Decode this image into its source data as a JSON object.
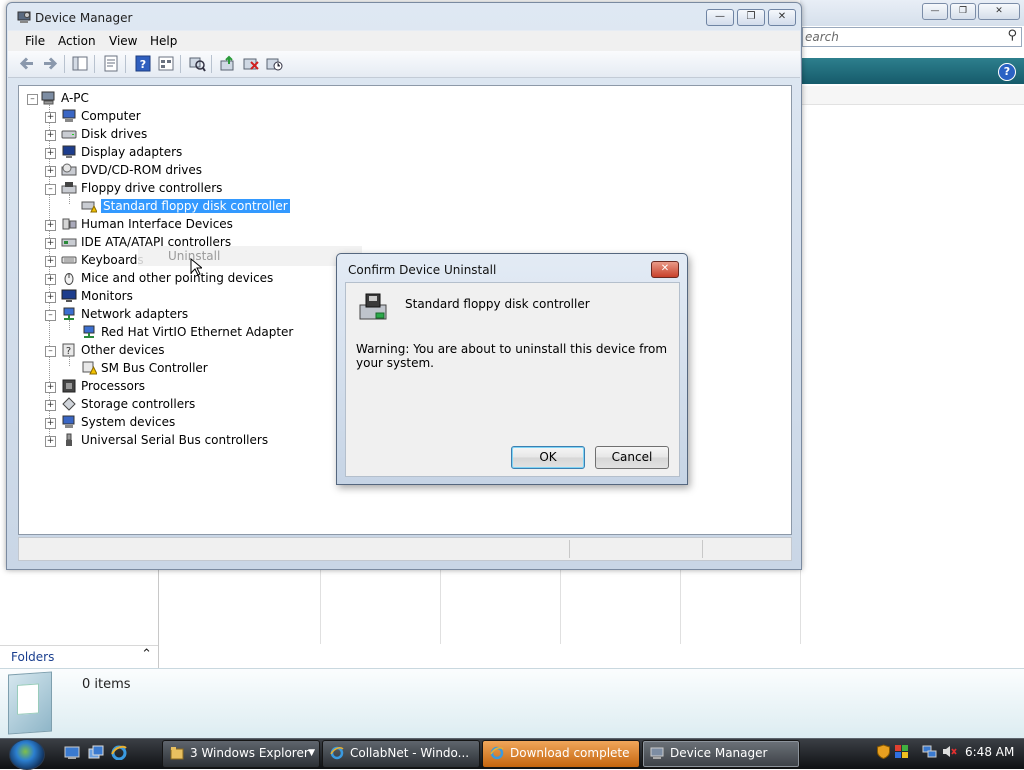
{
  "background": {
    "search_placeholder": "earch",
    "folders_label": "Folders",
    "items_count": "0 items"
  },
  "device_manager": {
    "title": "Device Manager",
    "menu": [
      "File",
      "Action",
      "View",
      "Help"
    ],
    "tree": {
      "root": "A-PC",
      "categories": [
        {
          "label": "Computer"
        },
        {
          "label": "Disk drives"
        },
        {
          "label": "Display adapters"
        },
        {
          "label": "DVD/CD-ROM drives"
        },
        {
          "label": "Floppy drive controllers",
          "expanded": true,
          "children": [
            "Standard floppy disk controller"
          ]
        },
        {
          "label": "Human Interface Devices"
        },
        {
          "label": "IDE ATA/ATAPI controllers"
        },
        {
          "label": "Keyboards"
        },
        {
          "label": "Mice and other pointing devices"
        },
        {
          "label": "Monitors"
        },
        {
          "label": "Network adapters",
          "expanded": true,
          "children": [
            "Red Hat VirtIO Ethernet Adapter"
          ]
        },
        {
          "label": "Other devices",
          "expanded": true,
          "children": [
            "SM Bus Controller"
          ]
        },
        {
          "label": "Processors"
        },
        {
          "label": "Storage controllers"
        },
        {
          "label": "System devices"
        },
        {
          "label": "Universal Serial Bus controllers"
        }
      ],
      "selected": "Standard floppy disk controller"
    },
    "context_ghost": "Uninstall"
  },
  "dialog": {
    "title": "Confirm Device Uninstall",
    "device_name": "Standard floppy disk controller",
    "warning": "Warning: You are about to uninstall this device from your system.",
    "ok_label": "OK",
    "cancel_label": "Cancel"
  },
  "taskbar": {
    "buttons": [
      {
        "label": "3 Windows Explorer"
      },
      {
        "label": "CollabNet - Windo..."
      },
      {
        "label": "Download complete"
      },
      {
        "label": "Device Manager"
      }
    ],
    "clock": "6:48 AM"
  },
  "colors": {
    "selection": "#3399ff",
    "cmdbar": "#1d6a78",
    "download_flash": "#e08a36"
  }
}
